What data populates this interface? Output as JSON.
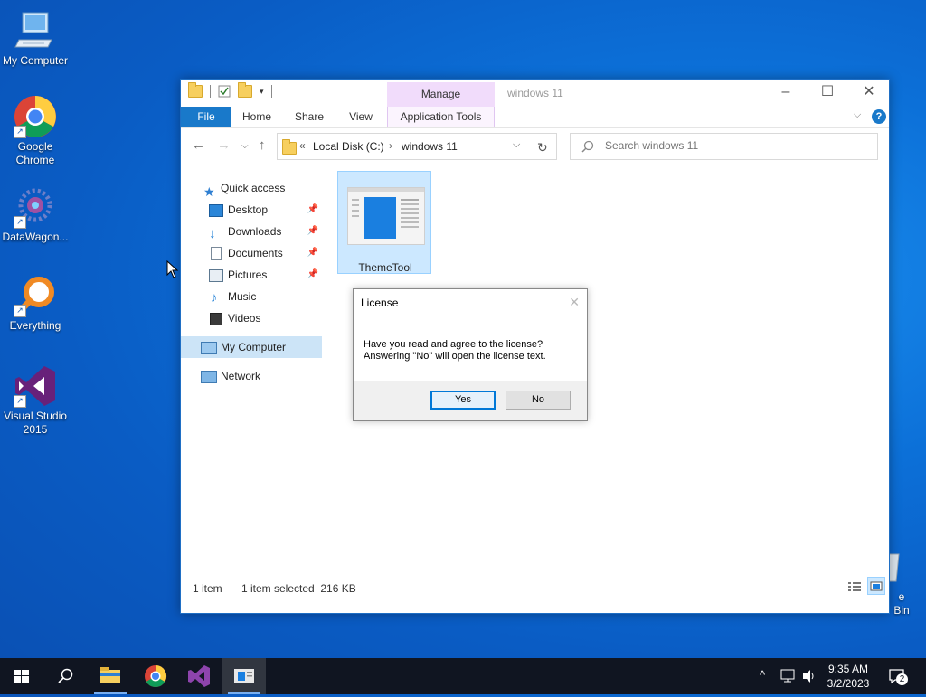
{
  "desktop": {
    "icons": [
      {
        "label": "My Computer"
      },
      {
        "label": "Google\nChrome"
      },
      {
        "label": "DataWagon..."
      },
      {
        "label": "Everything"
      },
      {
        "label": "Visual Studio\n2015"
      },
      {
        "label": "e Bin"
      }
    ]
  },
  "explorer": {
    "title": "windows 11",
    "manage_tab": "Manage",
    "ribbon_tabs": [
      "File",
      "Home",
      "Share",
      "View",
      "Application Tools"
    ],
    "breadcrumb": [
      "Local Disk (C:)",
      "windows 11"
    ],
    "breadcrumb_overflow": "«",
    "search_placeholder": "Search windows 11",
    "nav": {
      "quick_access": "Quick access",
      "items": [
        "Desktop",
        "Downloads",
        "Documents",
        "Pictures",
        "Music",
        "Videos"
      ],
      "pinned": [
        true,
        true,
        true,
        true,
        false,
        false
      ],
      "my_computer": "My Computer",
      "network": "Network"
    },
    "files": [
      {
        "name": "ThemeTool"
      }
    ],
    "status": {
      "count": "1 item",
      "selected": "1 item selected  216 KB"
    },
    "help_glyph": "?"
  },
  "dialog": {
    "title": "License",
    "line1": "Have you read and agree to the license?",
    "line2": "Answering \"No\" will open the license text.",
    "yes": "Yes",
    "no": "No"
  },
  "taskbar": {
    "time": "9:35 AM",
    "date": "3/2/2023",
    "notification_count": "2"
  },
  "colors": {
    "accent": "#0078d7",
    "file_tab": "#1979ca",
    "manage_tab": "#f1dcfb",
    "taskbar": "#101521"
  }
}
